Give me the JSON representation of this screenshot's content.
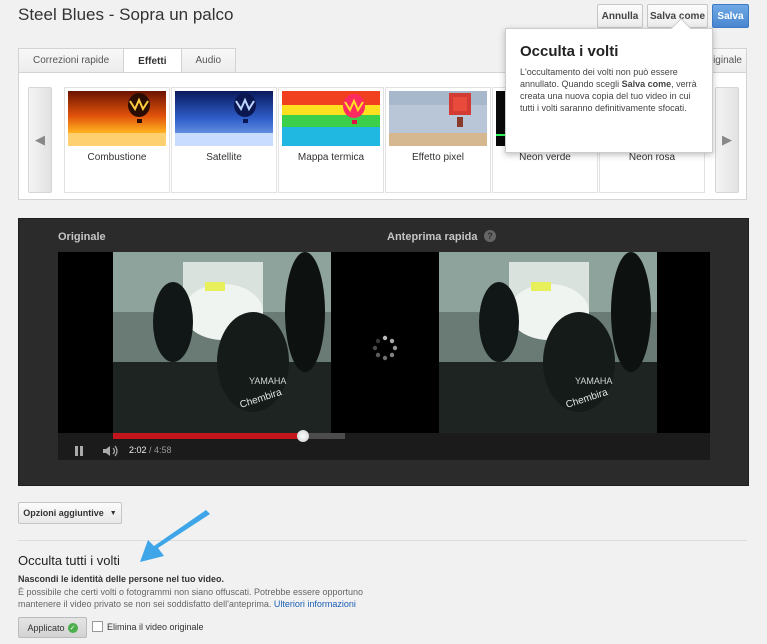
{
  "header": {
    "title": "Steel Blues - Sopra un palco",
    "buttons": {
      "cancel": "Annulla",
      "save_as": "Salva come",
      "save": "Salva"
    }
  },
  "tabs": [
    {
      "label": "Correzioni rapide",
      "active": false
    },
    {
      "label": "Effetti",
      "active": true
    },
    {
      "label": "Audio",
      "active": false
    }
  ],
  "tab_right_label": "originale",
  "effects": [
    {
      "label": "Combustione"
    },
    {
      "label": "Satellite"
    },
    {
      "label": "Mappa termica"
    },
    {
      "label": "Effetto pixel"
    },
    {
      "label": "Neon verde"
    },
    {
      "label": "Neon rosa"
    }
  ],
  "tooltip": {
    "title": "Occulta i volti",
    "text_before": "L'occultamento dei volti non può essere annullato. Quando scegli ",
    "text_bold": "Salva come",
    "text_after": ", verrà creata una nuova copia del tuo video in cui tutti i volti saranno definitivamente sfocati."
  },
  "preview": {
    "original_label": "Originale",
    "quick_preview_label": "Anteprima rapida",
    "help_icon": "?",
    "time_current": "2:02",
    "time_separator": " / ",
    "time_duration": "4:58",
    "progress": 0.82
  },
  "options_button": "Opzioni aggiuntive",
  "section": {
    "title": "Occulta tutti i volti",
    "subtitle": "Nascondi le identità delle persone nel tuo video.",
    "description": "È possibile che certi volti o fotogrammi non siano offuscati. Potrebbe essere opportuno mantenere il video privato se non sei soddisfatto dell'anteprima. ",
    "link": "Ulteriori informazioni",
    "applied_button": "Applicato",
    "checkbox_label": "Elimina il video originale"
  },
  "colors": {
    "accent": "#4a86d0",
    "progress": "#c4151c",
    "link": "#1a5fb4"
  }
}
